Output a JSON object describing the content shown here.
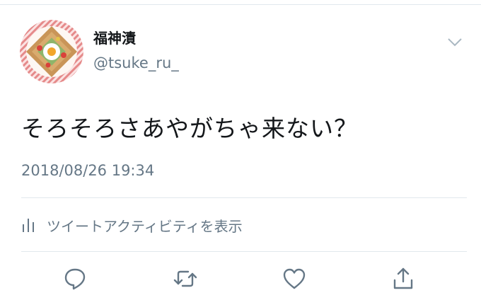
{
  "user": {
    "display_name": "福神漬",
    "handle": "@tsuke_ru_"
  },
  "tweet": {
    "text": "そろそろさあやがちゃ来ない？",
    "timestamp": "2018/08/26 19:34"
  },
  "activity": {
    "label": "ツイートアクティビティを表示",
    "icon": "bar-chart-icon"
  },
  "actions": {
    "icons": [
      "reply-icon",
      "retweet-icon",
      "like-icon",
      "share-icon"
    ]
  },
  "colors": {
    "text": "#14171a",
    "secondary": "#657786",
    "divider": "#e1e8ed"
  }
}
